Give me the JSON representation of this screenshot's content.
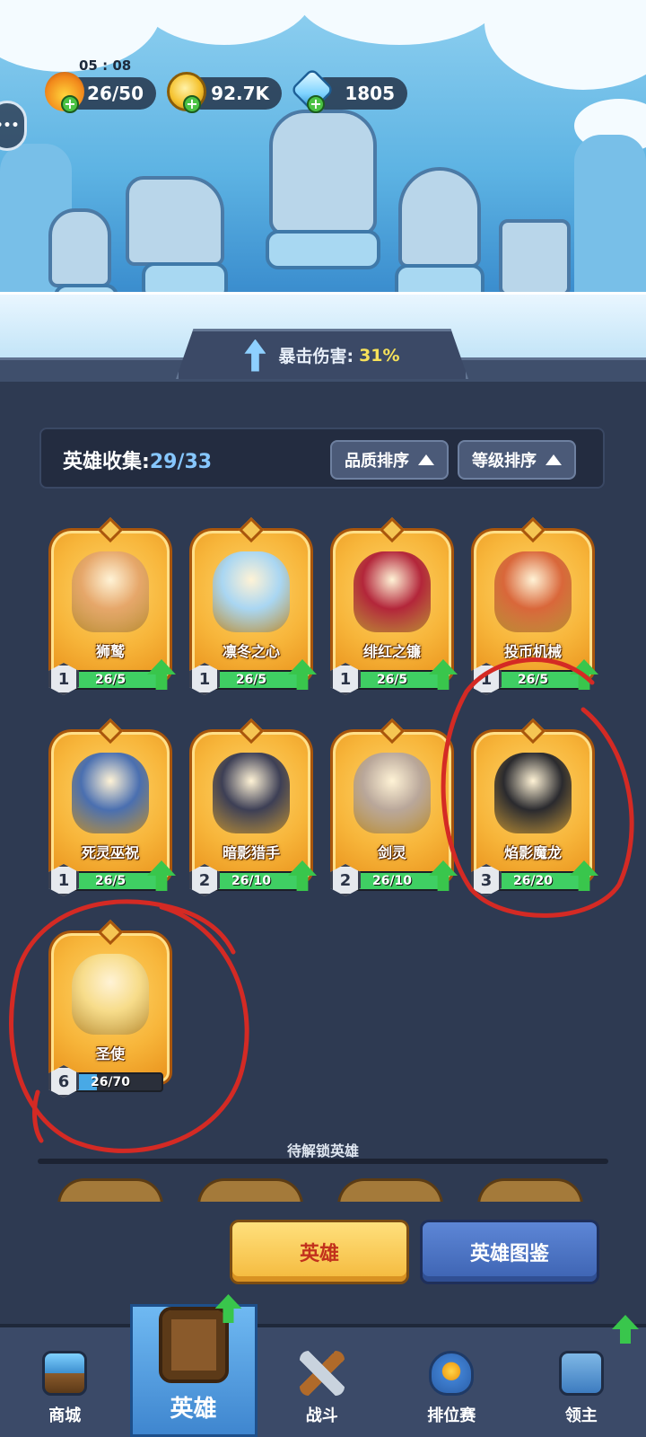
{
  "status": {
    "timer": "05 : 08"
  },
  "resources": [
    {
      "icon": "energy-flame-icon",
      "value": "26/50",
      "color": "#f28a1c"
    },
    {
      "icon": "gold-coin-icon",
      "value": "92.7K",
      "color": "#f5c22f"
    },
    {
      "icon": "ice-crystal-icon",
      "value": "1805",
      "color": "#7fd3ff"
    }
  ],
  "side_button": {
    "icon": "chat-bubble-icon",
    "label": "•••"
  },
  "crit_banner": {
    "label": "暴击伤害:",
    "value": "31%"
  },
  "collection": {
    "title": "英雄收集:",
    "count": "29/33",
    "sort_quality": "品质排序",
    "sort_level": "等级排序"
  },
  "heroes": [
    {
      "name": "狮鹫",
      "level": "1",
      "progress": "26/5",
      "fill": 1.0,
      "upgradable": true,
      "art_color": "#e6a76a"
    },
    {
      "name": "凛冬之心",
      "level": "1",
      "progress": "26/5",
      "fill": 1.0,
      "upgradable": true,
      "art_color": "#a9d6f2"
    },
    {
      "name": "绯红之镰",
      "level": "1",
      "progress": "26/5",
      "fill": 1.0,
      "upgradable": true,
      "art_color": "#b3263a"
    },
    {
      "name": "投币机械",
      "level": "1",
      "progress": "26/5",
      "fill": 1.0,
      "upgradable": true,
      "art_color": "#d9673a"
    },
    {
      "name": "死灵巫祝",
      "level": "1",
      "progress": "26/5",
      "fill": 1.0,
      "upgradable": true,
      "art_color": "#4a6fb0"
    },
    {
      "name": "暗影猎手",
      "level": "2",
      "progress": "26/10",
      "fill": 1.0,
      "upgradable": true,
      "art_color": "#3d3f55"
    },
    {
      "name": "剑灵",
      "level": "2",
      "progress": "26/10",
      "fill": 1.0,
      "upgradable": true,
      "art_color": "#b9a79a"
    },
    {
      "name": "焰影魔龙",
      "level": "3",
      "progress": "26/20",
      "fill": 1.0,
      "upgradable": true,
      "art_color": "#2a2a2e"
    },
    {
      "name": "圣使",
      "level": "6",
      "progress": "26/70",
      "fill": 0.37,
      "upgradable": false,
      "art_color": "#f7dc8a"
    }
  ],
  "locked": {
    "label": "待解锁英雄"
  },
  "actions": {
    "hero": "英雄",
    "codex": "英雄图鉴"
  },
  "nav": [
    {
      "icon": "shop-chest-icon",
      "label": "商城"
    },
    {
      "icon": "hero-card-icon",
      "label": "英雄"
    },
    {
      "icon": "crossed-swords-icon",
      "label": "战斗"
    },
    {
      "icon": "ranked-shield-icon",
      "label": "排位赛"
    },
    {
      "icon": "lord-banner-icon",
      "label": "领主"
    }
  ]
}
